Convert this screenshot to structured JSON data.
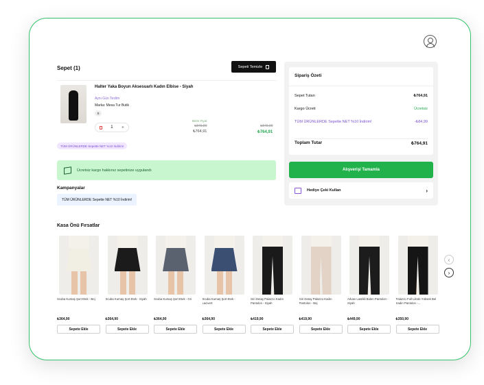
{
  "cart": {
    "title": "Sepet (1)",
    "clear_label": "Sepeti Temizle",
    "item": {
      "name": "Halter Yaka Boyun Aksesuarlı Kadın Elbise - Siyah",
      "date": "Aynı Gün Teslim",
      "brand": "Marka: Mesa Tur Butik",
      "size": "S",
      "qty": "1",
      "unit_label": "Birim Fiyat",
      "unit_old": "₺849,90",
      "unit_price": "₺764,91",
      "total_old": "₺849,90",
      "total_price": "₺764,91",
      "promo": "TÜM ÜRÜNLERDE Sepette NET %10 İndirim!"
    },
    "shipping_msg": "Ücretsiz kargo hakkınız sepetinize uygulandı",
    "campaigns_title": "Kampanyalar",
    "campaign_tag": "TÜM ÜRÜNLERDE Sepette NET %10 İndirim!"
  },
  "summary": {
    "title": "Sipariş Özeti",
    "subtotal_label": "Sepet Tutarı",
    "subtotal_value": "₺764,91",
    "shipping_label": "Kargo Ücreti",
    "shipping_value": "Ücretsiz",
    "discount_label": "TÜM ÜRÜNLERDE Sepette NET %10 İndirim!",
    "discount_value": "-₺84,99",
    "total_label": "Toplam Tutar",
    "total_value": "₺764,91",
    "checkout_label": "Alışverişi Tamamla",
    "gift_label": "Hediye Çeki Kullan"
  },
  "recommend": {
    "title": "Kasa Önü Fırsatlar",
    "add_label": "Sepete Ekle",
    "items": [
      {
        "name": "Scuba Kumaş Şort Etek - Bej",
        "price": "₺364,90",
        "color": "#f1efe3",
        "kind": "skirt"
      },
      {
        "name": "Scuba Kumaş Şort Etek - Siyah",
        "price": "₺364,90",
        "color": "#1b1b1b",
        "kind": "skirt"
      },
      {
        "name": "Scuba Kumaş Şort Etek - Gri",
        "price": "₺364,90",
        "color": "#5a6270",
        "kind": "skirt"
      },
      {
        "name": "Scuba Kumaş Şort Etek - Lacivert",
        "price": "₺364,90",
        "color": "#3b4f73",
        "kind": "skirt"
      },
      {
        "name": "Giri Detay Palazzo Kadın Pantolon - Siyah",
        "price": "₺419,90",
        "color": "#1a1a1a",
        "kind": "pants"
      },
      {
        "name": "Giri Detay Palazzo Kadın Pantolon - Bej",
        "price": "₺419,90",
        "color": "#e3d3c6",
        "kind": "pants"
      },
      {
        "name": "Arkası Lastikli Bolen Pantolon - Siyah",
        "price": "₺449,90",
        "color": "#1c1c1c",
        "kind": "pants"
      },
      {
        "name": "Palazzo Full Likralı Yüksek Bel Kadın Pantolon -...",
        "price": "₺350,90",
        "color": "#151515",
        "kind": "pants"
      }
    ]
  }
}
